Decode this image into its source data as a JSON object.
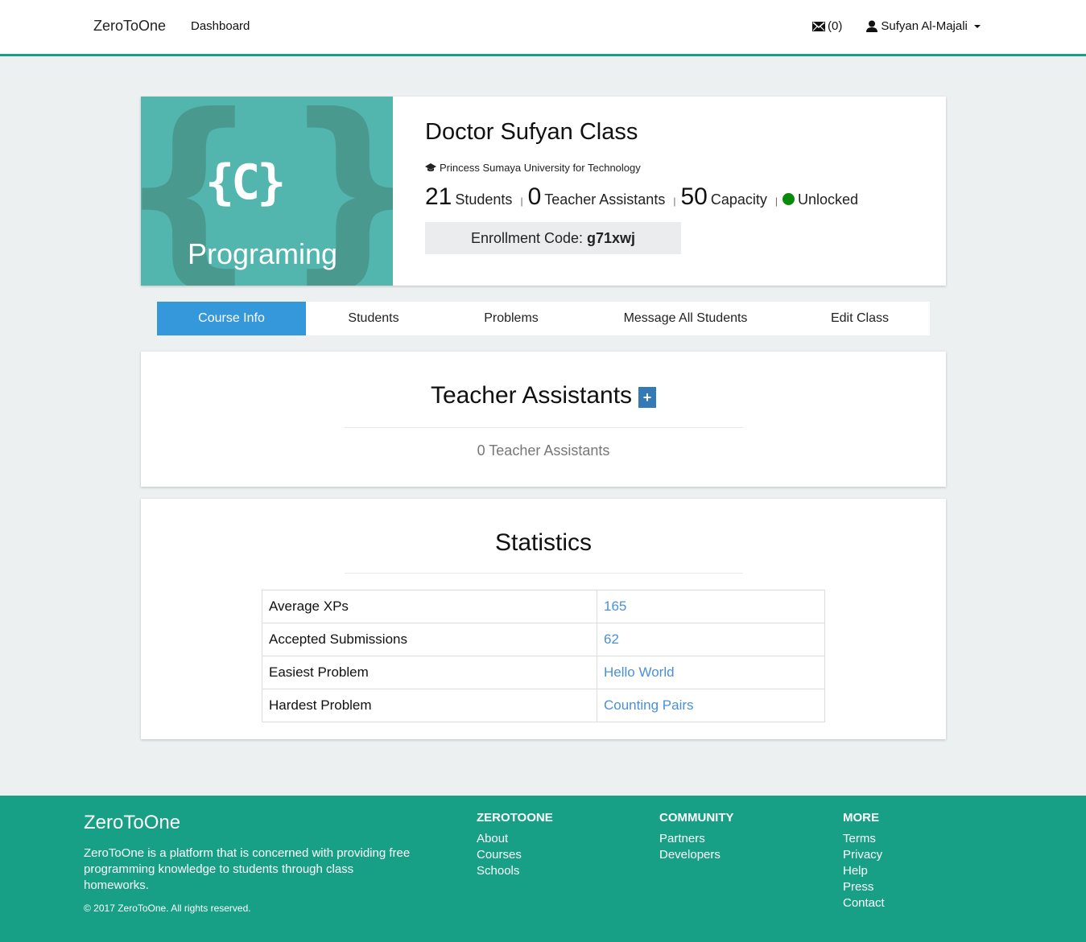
{
  "navbar": {
    "brand": "ZeroToOne",
    "links": [
      "Dashboard"
    ],
    "messages_icon": "envelope-icon",
    "messages_count": "(0)",
    "user_icon": "user-icon",
    "user_name": "Sufyan Al-Majali"
  },
  "class": {
    "image": {
      "code_label": "{C}",
      "text": "Programing",
      "background_color": "#52b5ae"
    },
    "title": "Doctor Sufyan Class",
    "school_icon": "graduation-cap-icon",
    "school": "Princess Sumaya University for Technology",
    "stats": {
      "students_count": "21",
      "students_label": "Students",
      "ta_count": "0",
      "ta_label": "Teacher Assistants",
      "capacity_count": "50",
      "capacity_label": "Capacity",
      "status": "Unlocked",
      "status_color": "#0a8a0a",
      "separator": "|"
    },
    "enrollment_label": "Enrollment Code:",
    "enrollment_code": "g71xwj"
  },
  "tabs": [
    {
      "label": "Course Info",
      "active": true
    },
    {
      "label": "Students",
      "active": false
    },
    {
      "label": "Problems",
      "active": false
    },
    {
      "label": "Message All Students",
      "active": false
    },
    {
      "label": "Edit Class",
      "active": false
    }
  ],
  "teacher_assistants": {
    "title": "Teacher Assistants",
    "add_icon": "+",
    "empty_text": "0 Teacher Assistants"
  },
  "statistics": {
    "title": "Statistics",
    "rows": [
      {
        "label": "Average XPs",
        "value": "165"
      },
      {
        "label": "Accepted Submissions",
        "value": "62"
      },
      {
        "label": "Easiest Problem",
        "value": "Hello World"
      },
      {
        "label": "Hardest Problem",
        "value": "Counting Pairs"
      }
    ]
  },
  "footer": {
    "brand": "ZeroToOne",
    "description": "ZeroToOne is a platform that is concerned with providing free programming knowledge to students through class homeworks.",
    "copyright": "© 2017 ZeroToOne. All rights reserved.",
    "columns": [
      {
        "heading": "ZEROTOONE",
        "links": [
          "About",
          "Courses",
          "Schools"
        ]
      },
      {
        "heading": "COMMUNITY",
        "links": [
          "Partners",
          "Developers"
        ]
      },
      {
        "heading": "MORE",
        "links": [
          "Terms",
          "Privacy",
          "Help",
          "Press",
          "Contact"
        ]
      }
    ],
    "background_color": "#17a086"
  },
  "colors": {
    "accent": "#18a085",
    "active_tab": "#3498db",
    "link": "#4a90d9",
    "add_button": "#337ab7"
  }
}
